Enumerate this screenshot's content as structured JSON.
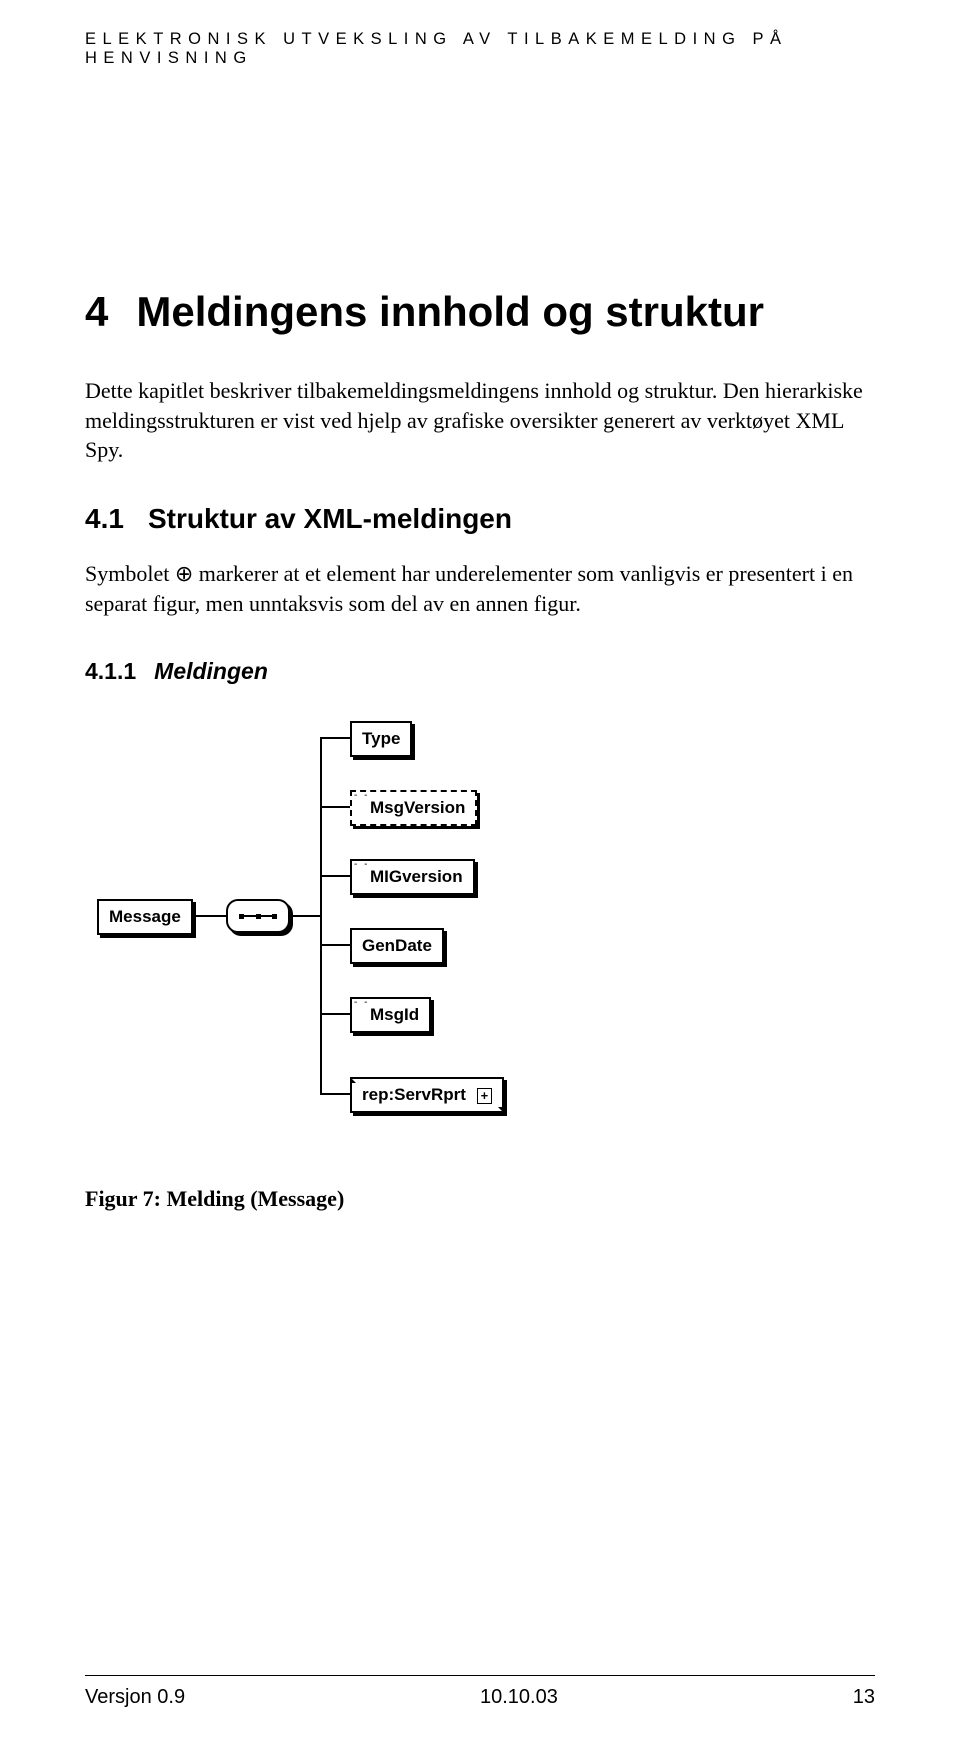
{
  "header": {
    "running_title": "ELEKTRONISK UTVEKSLING AV TILBAKEMELDING PÅ HENVISNING"
  },
  "chapter": {
    "number": "4",
    "title": "Meldingens innhold og struktur",
    "intro": "Dette kapitlet beskriver tilbakemeldingsmeldingens innhold og struktur. Den hierarkiske meldingsstrukturen er vist ved hjelp av grafiske oversikter generert av verktøyet XML Spy."
  },
  "section41": {
    "number": "4.1",
    "title": "Struktur av XML-meldingen",
    "para_before": "Symbolet ",
    "symbol": "⊕",
    "para_after": " markerer at et element har underelementer som vanligvis er presentert i en separat figur, men unntaksvis som del av en annen figur."
  },
  "section411": {
    "number": "4.1.1",
    "title": "Meldingen"
  },
  "diagram": {
    "root": "Message",
    "children": [
      {
        "label": "Type",
        "optional": false,
        "eq": false,
        "expand": false
      },
      {
        "label": "MsgVersion",
        "optional": true,
        "eq": true,
        "expand": false
      },
      {
        "label": "MIGversion",
        "optional": false,
        "eq": true,
        "expand": false
      },
      {
        "label": "GenDate",
        "optional": false,
        "eq": false,
        "expand": false
      },
      {
        "label": "MsgId",
        "optional": false,
        "eq": true,
        "expand": false
      },
      {
        "label": "rep:ServRprt",
        "optional": false,
        "eq": false,
        "expand": true
      }
    ],
    "expand_glyph": "+"
  },
  "figure_caption": "Figur 7: Melding (Message)",
  "footer": {
    "version": "Versjon 0.9",
    "date": "10.10.03",
    "page": "13"
  }
}
